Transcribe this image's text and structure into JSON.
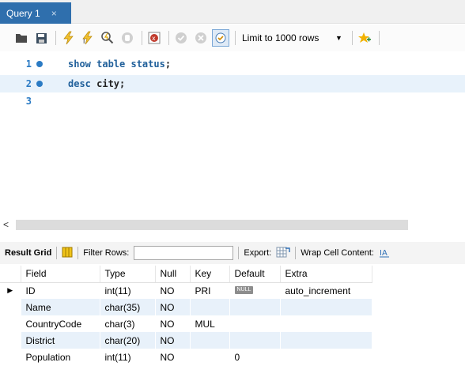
{
  "tab": {
    "title": "Query 1",
    "close": "×"
  },
  "toolbar": {
    "limit_label": "Limit to 1000 rows",
    "icons": [
      "folder-icon",
      "save-icon",
      "execute-icon",
      "execute-current-icon",
      "explain-icon",
      "stop-icon",
      "toggle-error-icon",
      "commit-icon",
      "rollback-icon",
      "autocommit-icon",
      "bookmark-icon"
    ]
  },
  "editor": {
    "lines": [
      {
        "num": "1",
        "keyword": "show table status",
        "rest": ";",
        "marker": true
      },
      {
        "num": "2",
        "keyword": "desc",
        "rest": " city;",
        "marker": true
      },
      {
        "num": "3",
        "keyword": "",
        "rest": "",
        "marker": false
      }
    ]
  },
  "result_toolbar": {
    "result_grid": "Result Grid",
    "filter_rows": "Filter Rows:",
    "export": "Export:",
    "wrap": "Wrap Cell Content:"
  },
  "table": {
    "columns": [
      "Field",
      "Type",
      "Null",
      "Key",
      "Default",
      "Extra"
    ],
    "rows": [
      [
        "ID",
        "int(11)",
        "NO",
        "PRI",
        "NULL",
        "auto_increment"
      ],
      [
        "Name",
        "char(35)",
        "NO",
        "",
        "",
        ""
      ],
      [
        "CountryCode",
        "char(3)",
        "NO",
        "MUL",
        "",
        ""
      ],
      [
        "District",
        "char(20)",
        "NO",
        "",
        "",
        ""
      ],
      [
        "Population",
        "int(11)",
        "NO",
        "",
        "0",
        ""
      ]
    ]
  },
  "colors": {
    "tab": "#2f6fad",
    "keyword": "#1f5f9a",
    "line_number": "#2b7bc4",
    "row_alt": "#e8f1fa"
  }
}
